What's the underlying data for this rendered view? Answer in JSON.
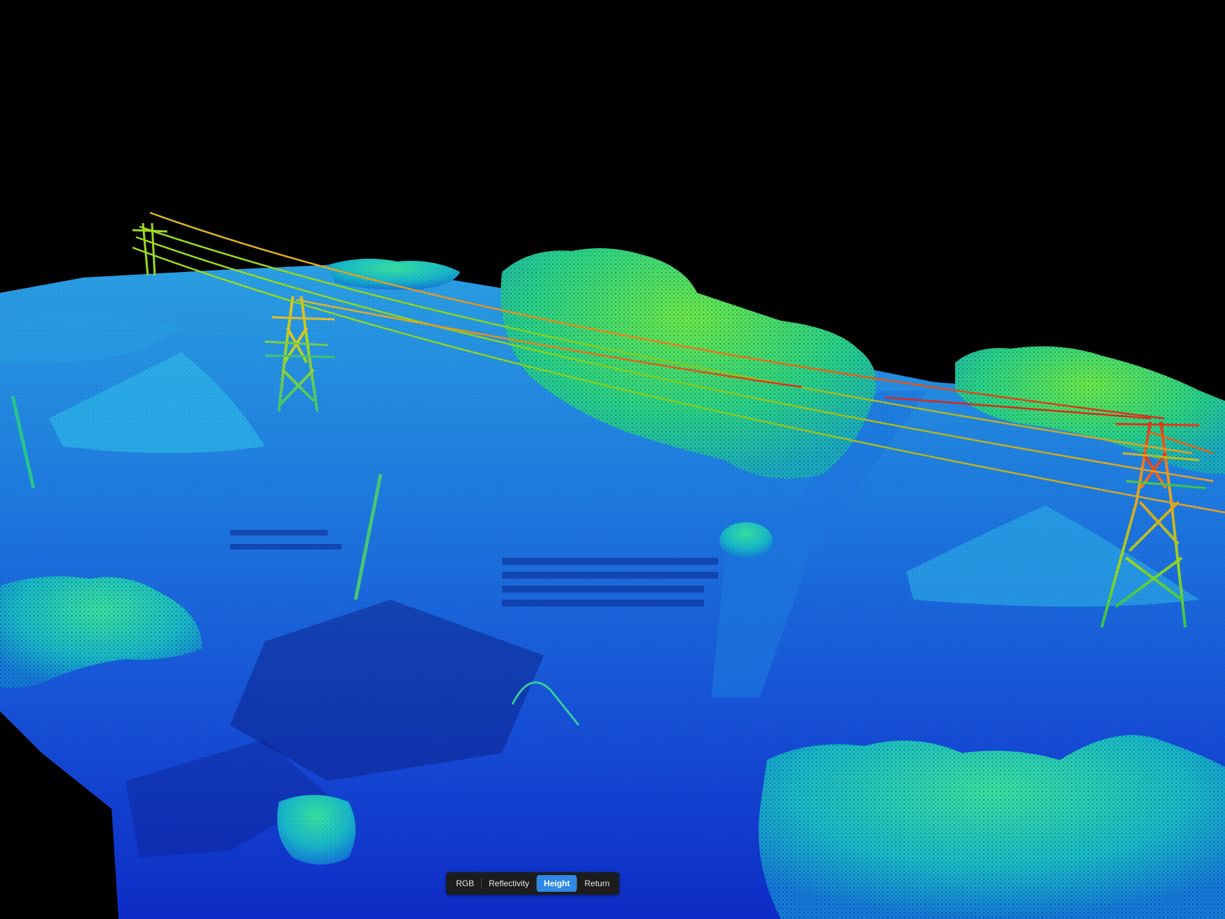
{
  "viewer": {
    "background_color": "#000000",
    "color_mode": "Height",
    "height_ramp": [
      "#0a1ecc",
      "#1e64e6",
      "#22a8e0",
      "#20d8b0",
      "#3ee868",
      "#9ae020",
      "#f0c020",
      "#f05010",
      "#e01818"
    ]
  },
  "mode_toggle": {
    "buttons": [
      {
        "label": "RGB",
        "active": false
      },
      {
        "label": "Reflectivity",
        "active": false
      },
      {
        "label": "Height",
        "active": true
      },
      {
        "label": "Return",
        "active": false
      }
    ],
    "active_color": "#2e88e6"
  }
}
